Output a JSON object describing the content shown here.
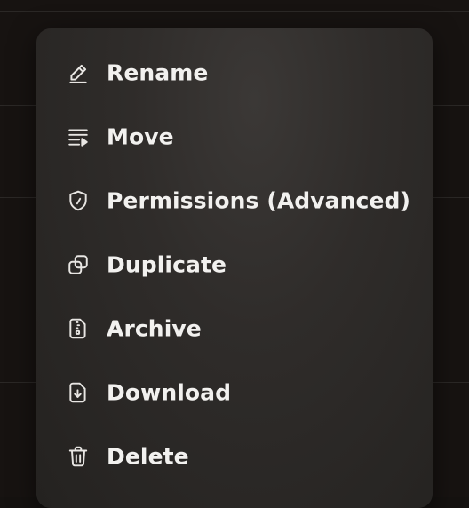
{
  "menu": {
    "items": [
      {
        "label": "Rename",
        "icon": "pencil-icon"
      },
      {
        "label": "Move",
        "icon": "move-list-icon"
      },
      {
        "label": "Permissions (Advanced)",
        "icon": "shield-icon"
      },
      {
        "label": "Duplicate",
        "icon": "duplicate-icon"
      },
      {
        "label": "Archive",
        "icon": "archive-file-icon"
      },
      {
        "label": "Download",
        "icon": "download-file-icon"
      },
      {
        "label": "Delete",
        "icon": "trash-icon"
      }
    ]
  },
  "colors": {
    "background": "#171311",
    "menu_surface": "#2f2c2a",
    "text": "#f2f1ef",
    "icon": "#e8e6e3"
  }
}
